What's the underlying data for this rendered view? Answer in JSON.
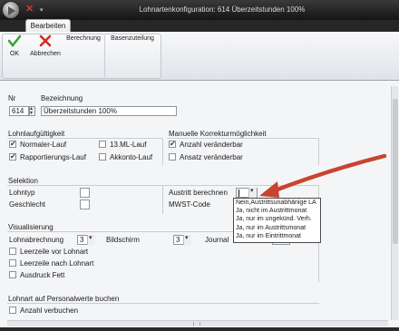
{
  "window": {
    "title": "Lohnartenkonfiguration: 614 Überzeitstunden 100%"
  },
  "ribbon": {
    "tab": "Bearbeiten",
    "ok_label": "OK",
    "abbrechen_label": "Abbrechen",
    "berechnung_label": "Berechnung",
    "basenzuteilung_label": "Basenzuteilung"
  },
  "header": {
    "nr_label": "Nr",
    "nr_value": "614",
    "bezeichnung_label": "Bezeichnung",
    "bezeichnung_value": "Überzeitstunden 100%"
  },
  "lohnlaufgueltigkeit": {
    "title": "Lohnlaufgültigkeit",
    "normaler_lauf": {
      "label": "Normaler-Lauf",
      "checked": true
    },
    "rapportierungs_lauf": {
      "label": "Rapportierungs-Lauf",
      "checked": true
    },
    "ml_lauf": {
      "label": "13.ML-Lauf",
      "checked": false
    },
    "akkonto_lauf": {
      "label": "Akkonto-Lauf",
      "checked": false
    }
  },
  "manuelle_korrektur": {
    "title": "Manuelle Korrekturmöglichkeit",
    "anzahl": {
      "label": "Anzahl veränderbar",
      "checked": true
    },
    "ansatz": {
      "label": "Ansatz veränderbar",
      "checked": false
    }
  },
  "selektion": {
    "title": "Selektion",
    "lohntyp_label": "Lohntyp",
    "geschlecht_label": "Geschlecht",
    "austritt_label": "Austritt berechnen",
    "mwst_label": "MWST-Code",
    "austritt_options": [
      "Nein,Austrittsunabhänige LA",
      "Ja, nicht im Austrittmonat",
      "Ja, nur im ungekünd. Verh.",
      "Ja, nur im Austrittsmonat",
      "Ja, nur im Eintrittmonat"
    ]
  },
  "visualisierung": {
    "title": "Visualisierung",
    "lohnabrechnung_label": "Lohnabrechnung",
    "lohnabrechnung_value": "3",
    "bildschirm_label": "Bildschirm",
    "bildschirm_value": "3",
    "journal_label": "Journal",
    "leerzeile_vor": {
      "label": "Leerzeile vor Lohnart",
      "checked": false
    },
    "leerzeile_nach": {
      "label": "Leerzeile nach Lohnart",
      "checked": false
    },
    "ausdruck_fett": {
      "label": "Ausdruck Fett",
      "checked": false
    }
  },
  "personalwerte": {
    "title": "Lohnart auf Personalwerte buchen",
    "anzahl_verbuchen": {
      "label": "Anzahl verbuchen",
      "checked": false
    }
  },
  "colors": {
    "title_bar": "#1c1c1c",
    "annotation_arrow": "#c8442f",
    "ok_check": "#3aa33a",
    "cancel_x": "#d42a1f"
  }
}
